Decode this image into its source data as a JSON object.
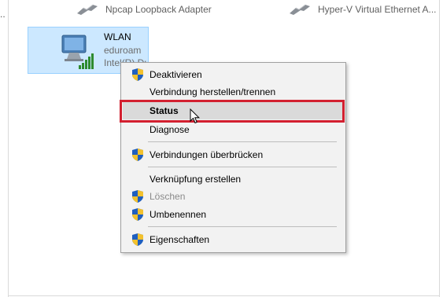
{
  "dots": "..",
  "top_adapters": [
    {
      "name": "Npcap Loopback Adapter",
      "icon": "network-cable-icon"
    },
    {
      "name": "Hyper-V Virtual Ethernet A...",
      "icon": "network-cable-icon"
    }
  ],
  "wlan": {
    "title": "WLAN",
    "network": "eduroam",
    "device": "Intel(R) Dual Band Wireless",
    "icon": "wireless-adapter-icon"
  },
  "context_menu": {
    "items": [
      {
        "label": "Deaktivieren",
        "icon": "uac-shield-icon"
      },
      {
        "label": "Verbindung herstellen/trennen"
      },
      {
        "label": "Status",
        "bold": true,
        "hovered": true
      },
      {
        "label": "Diagnose"
      },
      {
        "label": "Verbindungen überbrücken",
        "icon": "uac-shield-icon"
      },
      {
        "label": "Verknüpfung erstellen"
      },
      {
        "label": "Löschen",
        "icon": "uac-shield-icon",
        "disabled": true
      },
      {
        "label": "Umbenennen",
        "icon": "uac-shield-icon"
      },
      {
        "label": "Eigenschaften",
        "icon": "uac-shield-icon"
      }
    ]
  },
  "colors": {
    "selection": "#cce8ff",
    "highlight_border": "#d32030",
    "menu_background": "#f2f2f2"
  }
}
